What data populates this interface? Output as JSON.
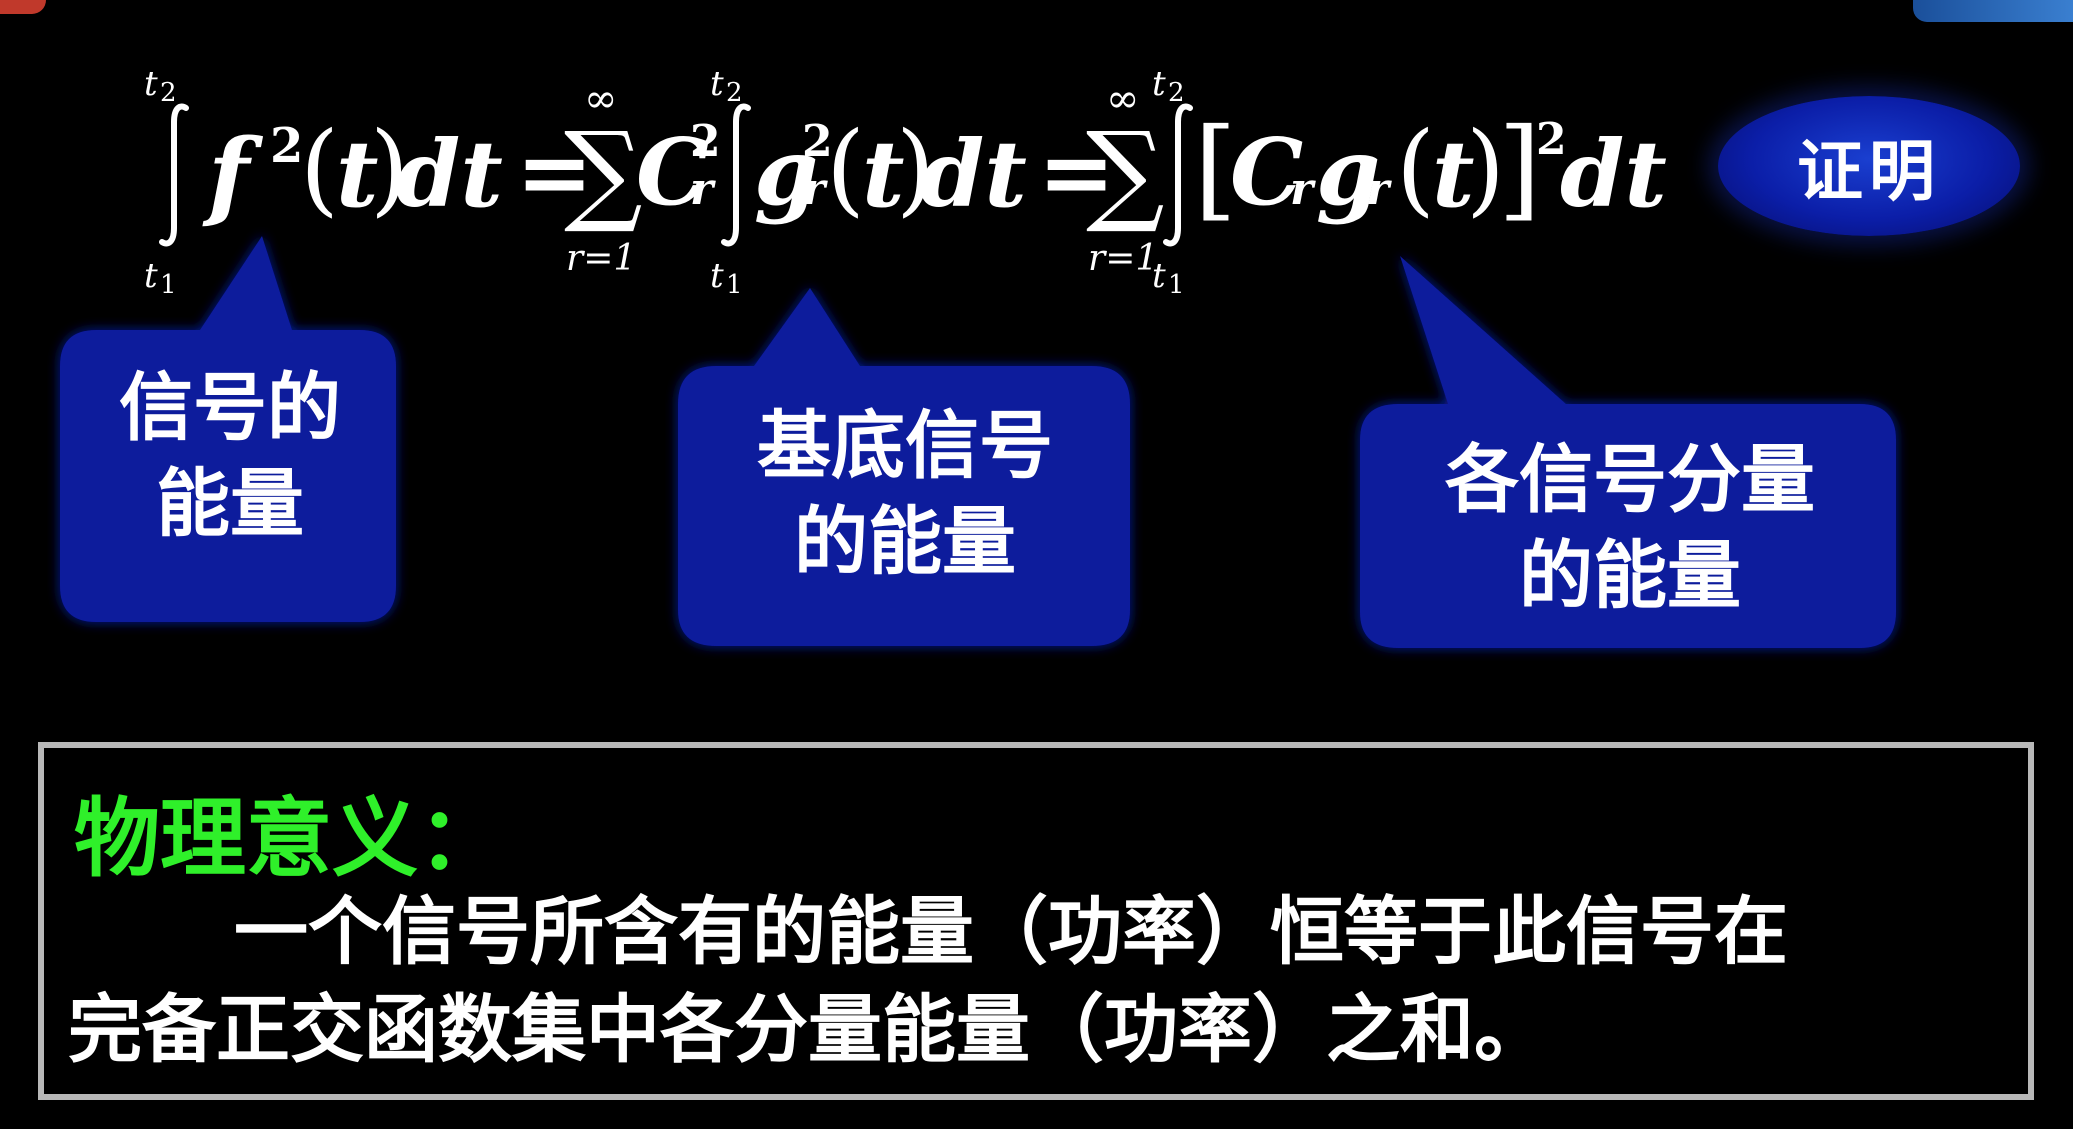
{
  "formula": {
    "integral_upper": "t2",
    "integral_lower": "t1",
    "integrand_left": "f",
    "square": "2",
    "arg_open": "(",
    "arg_var": "t",
    "arg_close": ")",
    "differential": "dt",
    "equals": "=",
    "sum_upper": "∞",
    "sum_lower": "r=1",
    "coef": "C",
    "coef_sub": "r",
    "coef_sup": "2",
    "basis": "g",
    "basis_sub": "r",
    "basis_sup": "2",
    "bracket_open": "[",
    "bracket_close": "]"
  },
  "callouts": {
    "signal_energy": [
      "信号的",
      "能量"
    ],
    "basis_energy": [
      "基底信号",
      "的能量"
    ],
    "component_energy": [
      "各信号分量",
      "的能量"
    ]
  },
  "proof_button": {
    "label": "证明"
  },
  "meaning": {
    "title": "物理意义：",
    "line1": "一个信号所含有的能量（功率）恒等于此信号在",
    "line2": "完备正交函数集中各分量能量（功率）之和。"
  },
  "colors": {
    "background": "#000000",
    "callout_fill": "#0b1a9c",
    "meaning_title": "#2ff02a",
    "panel_border": "#b8b8b8"
  }
}
